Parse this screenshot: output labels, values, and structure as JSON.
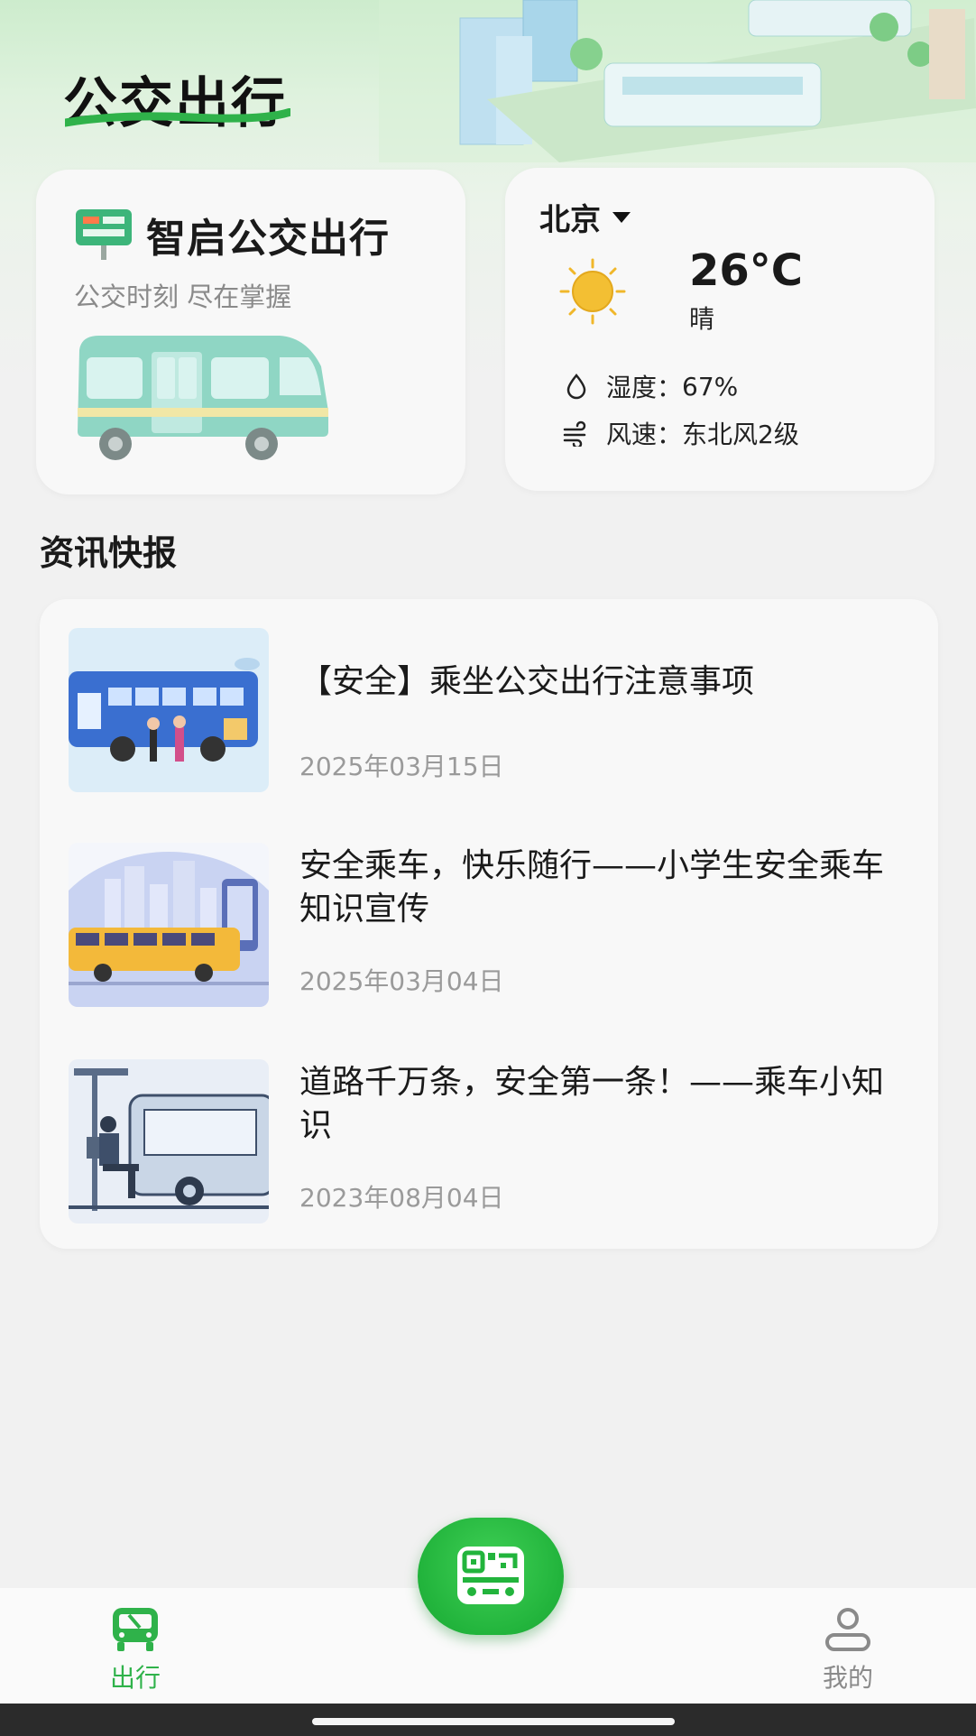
{
  "header": {
    "title": "公交出行"
  },
  "brand_card": {
    "name": "智启公交出行",
    "slogan": "公交时刻 尽在掌握"
  },
  "weather": {
    "city": "北京",
    "temperature": "26°C",
    "condition": "晴",
    "humidity_label": "湿度：",
    "humidity_value": "67%",
    "wind_label": "风速：",
    "wind_value": "东北风2级"
  },
  "news": {
    "section_title": "资讯快报",
    "items": [
      {
        "title": "【安全】乘坐公交出行注意事项",
        "date": "2025年03月15日"
      },
      {
        "title": "安全乘车，快乐随行——小学生安全乘车知识宣传",
        "date": "2025年03月04日"
      },
      {
        "title": "道路千万条，安全第一条！——乘车小知识",
        "date": "2023年08月04日"
      }
    ]
  },
  "tabbar": {
    "go_label": "出行",
    "me_label": "我的"
  },
  "colors": {
    "accent": "#2fb24a",
    "background": "#f1f1f1",
    "card": "#f8f8f8"
  },
  "icons": [
    "bus-stop-sign-icon",
    "caret-down-icon",
    "sun-icon",
    "droplet-icon",
    "wind-icon",
    "bus-tab-icon",
    "scan-bus-icon",
    "user-icon"
  ]
}
